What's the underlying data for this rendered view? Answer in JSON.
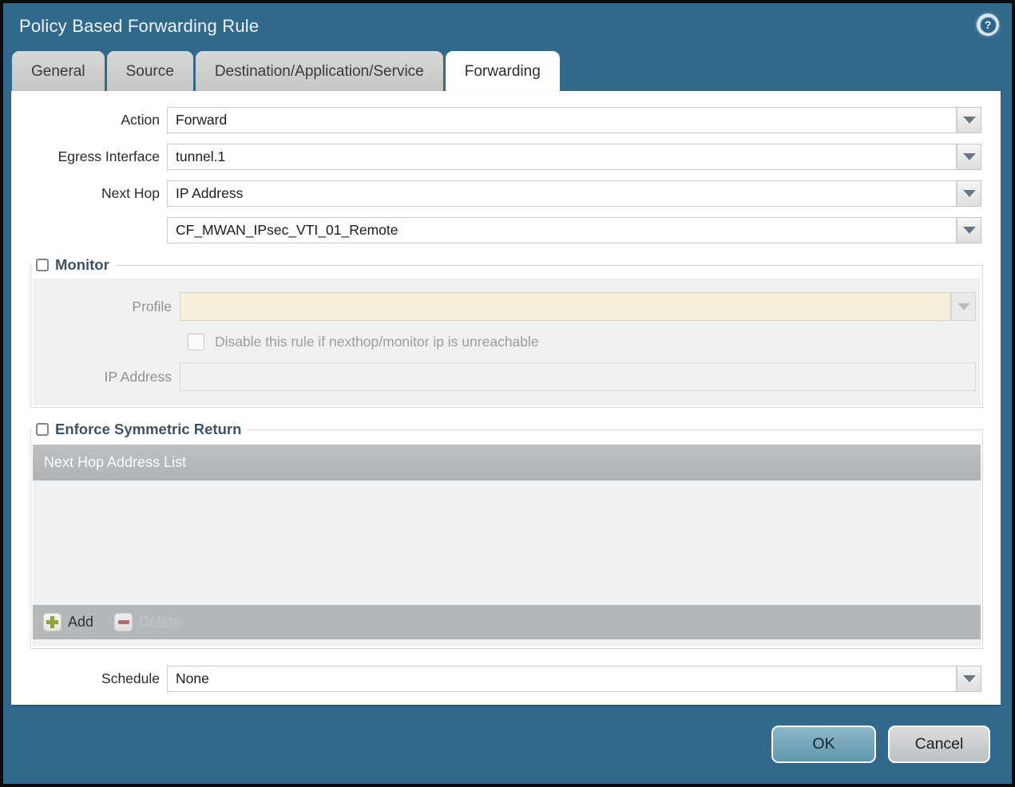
{
  "dialog": {
    "title": "Policy Based Forwarding Rule",
    "help_glyph": "?"
  },
  "tabs": [
    {
      "label": "General",
      "active": false
    },
    {
      "label": "Source",
      "active": false
    },
    {
      "label": "Destination/Application/Service",
      "active": false
    },
    {
      "label": "Forwarding",
      "active": true
    }
  ],
  "form": {
    "action": {
      "label": "Action",
      "value": "Forward"
    },
    "egress_interface": {
      "label": "Egress Interface",
      "value": "tunnel.1"
    },
    "next_hop": {
      "label": "Next Hop",
      "value": "IP Address"
    },
    "next_hop_address": {
      "label": "",
      "value": "CF_MWAN_IPsec_VTI_01_Remote"
    },
    "schedule": {
      "label": "Schedule",
      "value": "None"
    }
  },
  "monitor": {
    "legend": "Monitor",
    "checked": false,
    "profile": {
      "label": "Profile",
      "value": ""
    },
    "disable_rule": {
      "label": "Disable this rule if nexthop/monitor ip is unreachable",
      "checked": false
    },
    "ip_address": {
      "label": "IP Address",
      "value": ""
    }
  },
  "symmetric_return": {
    "legend": "Enforce Symmetric Return",
    "checked": false,
    "table": {
      "header": "Next Hop Address List",
      "rows": []
    },
    "add_label": "Add",
    "delete_label": "Delete",
    "delete_disabled": true
  },
  "footer": {
    "ok_label": "OK",
    "cancel_label": "Cancel"
  },
  "colors": {
    "titlebar_teal": "#31698C",
    "tab_gray": "#c9c9c9",
    "active_tab": "#ffffff",
    "legend_text": "#3E5266",
    "disabled_field_beige": "#f5eedb",
    "panel_gray": "#f0f0f1",
    "grid_header_gray": "#b3b7ba",
    "add_plus_green": "#8fa03c",
    "delete_minus_red": "#b26b74",
    "ok_button_teal": "#6FA6BC",
    "cancel_button_gray": "#c9cccf"
  }
}
